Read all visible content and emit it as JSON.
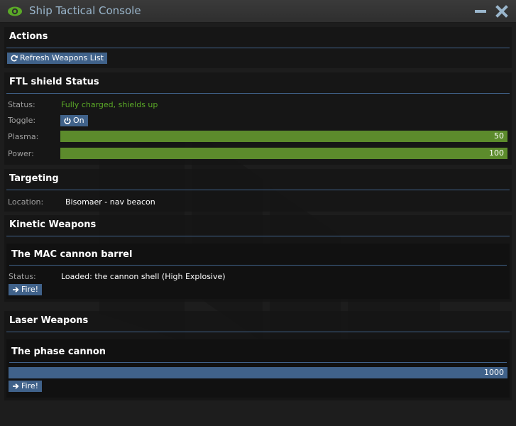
{
  "window": {
    "title": "Ship Tactical Console",
    "title_icon": "eye-icon",
    "minimize_icon": "minimize-icon",
    "close_icon": "close-icon"
  },
  "colors": {
    "accent": "#40628a",
    "good": "#5baa27",
    "bar_green": "#5c8b2c"
  },
  "actions": {
    "title": "Actions",
    "refresh_label": "Refresh Weapons List"
  },
  "ftl": {
    "title": "FTL shield Status",
    "status_label": "Status:",
    "status_value": "Fully charged, shields up",
    "toggle_label": "Toggle:",
    "toggle_value": "On",
    "plasma_label": "Plasma:",
    "plasma_value": "50",
    "plasma_fraction": 1.0,
    "power_label": "Power:",
    "power_value": "100",
    "power_fraction": 1.0
  },
  "targeting": {
    "title": "Targeting",
    "location_label": "Location:",
    "location_value": "Bisomaer - nav beacon"
  },
  "kinetic": {
    "title": "Kinetic Weapons",
    "weapon_name": "The MAC cannon barrel",
    "status_label": "Status:",
    "status_value": "Loaded: the cannon shell (High Explosive)",
    "fire_label": "Fire!"
  },
  "laser": {
    "title": "Laser Weapons",
    "weapon_name": "The phase cannon",
    "charge_value": "1000",
    "charge_fraction": 1.0,
    "fire_label": "Fire!"
  }
}
